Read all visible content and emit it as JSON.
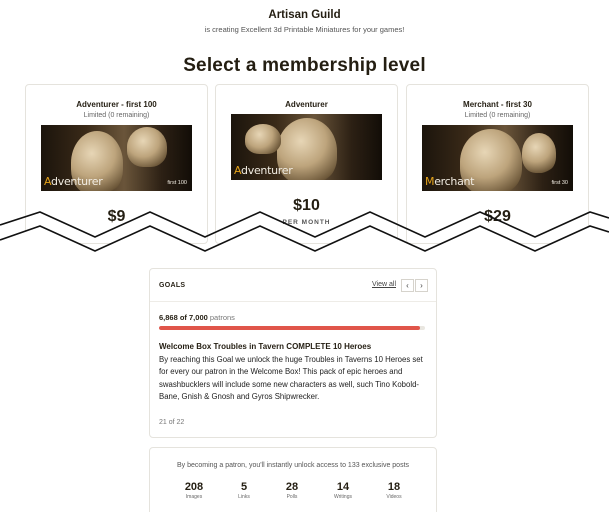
{
  "creator": {
    "name": "Artisan Guild",
    "tagline": "is creating Excellent 3d Printable Miniatures for your games!"
  },
  "section_title": "Select a membership level",
  "tiers": [
    {
      "name": "Adventurer - first 100",
      "limited": "Limited (0 remaining)",
      "banner_cap": "A",
      "banner_rest": "dventurer",
      "banner_tag": "first 100",
      "price": "$9",
      "period": ""
    },
    {
      "name": "Adventurer",
      "limited": "",
      "banner_cap": "A",
      "banner_rest": "dventurer",
      "banner_tag": "",
      "price": "$10",
      "period": "PER MONTH"
    },
    {
      "name": "Merchant - first 30",
      "limited": "Limited (0 remaining)",
      "banner_cap": "M",
      "banner_rest": "erchant",
      "banner_tag": "first 30",
      "price": "$29",
      "period": ""
    }
  ],
  "goals": {
    "title": "GOALS",
    "view_all": "View all",
    "prev_icon": "‹",
    "next_icon": "›",
    "current": "6,868 of 7,000",
    "unit": "patrons",
    "progress": 0.981,
    "goal_title": "Welcome Box Troubles in Tavern COMPLETE 10 Heroes",
    "goal_description": "By reaching this Goal we unlock the huge Troubles in Taverns 10 Heroes set for every our patron in the Welcome Box! This pack of epic heroes and swashbucklers will include some new characters as well, such Tino Kobold-Bane, Gnish & Gnosh and Gyros Shipwrecker.",
    "page": "21 of 22"
  },
  "stats": {
    "intro": "By becoming a patron, you'll instantly unlock access to 133 exclusive posts",
    "items": [
      {
        "count": "208",
        "label": "Images"
      },
      {
        "count": "5",
        "label": "Links"
      },
      {
        "count": "28",
        "label": "Polls"
      },
      {
        "count": "14",
        "label": "Writings"
      },
      {
        "count": "18",
        "label": "Videos"
      }
    ]
  },
  "colors": {
    "accent": "#e0554a",
    "brand_gold": "#e3a21a"
  }
}
